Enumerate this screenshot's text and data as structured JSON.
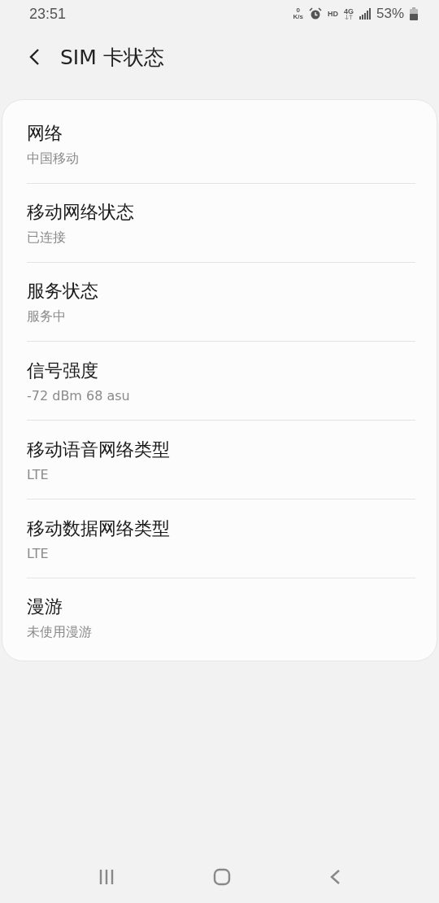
{
  "status_bar": {
    "time": "23:51",
    "speed_value": "0",
    "speed_unit": "K/s",
    "hd": "HD",
    "network": "4G",
    "battery": "53%"
  },
  "header": {
    "title": "SIM 卡状态"
  },
  "items": [
    {
      "title": "网络",
      "value": "中国移动"
    },
    {
      "title": "移动网络状态",
      "value": "已连接"
    },
    {
      "title": "服务状态",
      "value": "服务中"
    },
    {
      "title": "信号强度",
      "value": "-72 dBm 68 asu"
    },
    {
      "title": "移动语音网络类型",
      "value": "LTE"
    },
    {
      "title": "移动数据网络类型",
      "value": "LTE"
    },
    {
      "title": "漫游",
      "value": "未使用漫游"
    }
  ]
}
